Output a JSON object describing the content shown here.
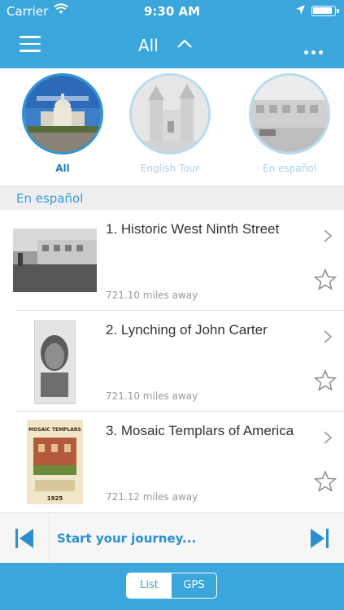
{
  "status_bar": {
    "carrier": "Carrier",
    "time": "9:30 AM"
  },
  "nav": {
    "title": "All"
  },
  "tours": [
    {
      "label": "All",
      "selected": true
    },
    {
      "label": "English Tour",
      "selected": false
    },
    {
      "label": "En español",
      "selected": false
    }
  ],
  "section": {
    "title": "En español"
  },
  "stops": [
    {
      "title": "1. Historic West Ninth Street",
      "distance": "721.10 miles away"
    },
    {
      "title": "2. Lynching of John Carter",
      "distance": "721.10 miles away"
    },
    {
      "title": "3. Mosaic Templars of America",
      "distance": "721.12 miles away"
    }
  ],
  "thumb_text": {
    "mosaic_top": "MOSAIC TEMPLARS",
    "mosaic_year": "1925"
  },
  "player": {
    "cta": "Start your journey..."
  },
  "view_toggle": {
    "list": "List",
    "gps": "GPS",
    "selected": "List"
  },
  "colors": {
    "accent": "#3aa6dc",
    "link": "#2a8fd0"
  }
}
